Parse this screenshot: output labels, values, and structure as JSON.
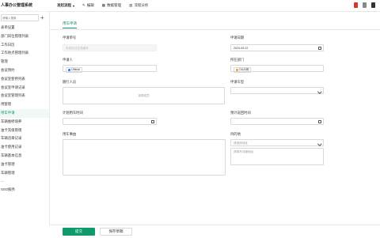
{
  "app": {
    "title": "人事办公管理系统"
  },
  "sidebar": {
    "search_placeholder": "请输入搜索",
    "items": [
      "表单设置",
      "部门岗位管理列表",
      "工作日历",
      "工作地点管理列表",
      "管理",
      "会议预约",
      "会议室使用列表",
      "会议室申请记录",
      "会议室管理列表",
      "用管理",
      "用车申请",
      "车辆维修保养",
      "油卡充值管理",
      "车辆违章记录",
      "油卡使用记录",
      "车辆基本信息",
      "油卡管理",
      "车辆管理",
      "...",
      "SSO服务"
    ],
    "active_index": 10
  },
  "topbar": {
    "items": [
      "发起流程",
      "编辑",
      "数据管理",
      "流程分析"
    ]
  },
  "tab": {
    "label": "用车申请"
  },
  "form": {
    "applicant_no": {
      "label": "申请单号",
      "placeholder": "系统自动生成编号"
    },
    "apply_date": {
      "label": "申请日期",
      "value": "2024-09-22"
    },
    "applicant": {
      "label": "申请人",
      "value": "Official"
    },
    "department": {
      "label": "所在部门",
      "value": "OA示例"
    },
    "companions": {
      "label": "随行人员",
      "placeholder": "选择成员"
    },
    "car_type": {
      "label": "申请车型",
      "value": ""
    },
    "planned_time": {
      "label": "计划用车时间",
      "value": ""
    },
    "return_time": {
      "label": "预计返回时间",
      "value": ""
    },
    "reason": {
      "label": "用车事由",
      "value": ""
    },
    "destination": {
      "label": "目的地",
      "select_placeholder": "请选择地址",
      "detail_placeholder": "请填写详细地址"
    }
  },
  "footer": {
    "submit_label": "提交",
    "draft_label": "保存草稿"
  },
  "colors": {
    "accent": "#0e9a6b"
  }
}
